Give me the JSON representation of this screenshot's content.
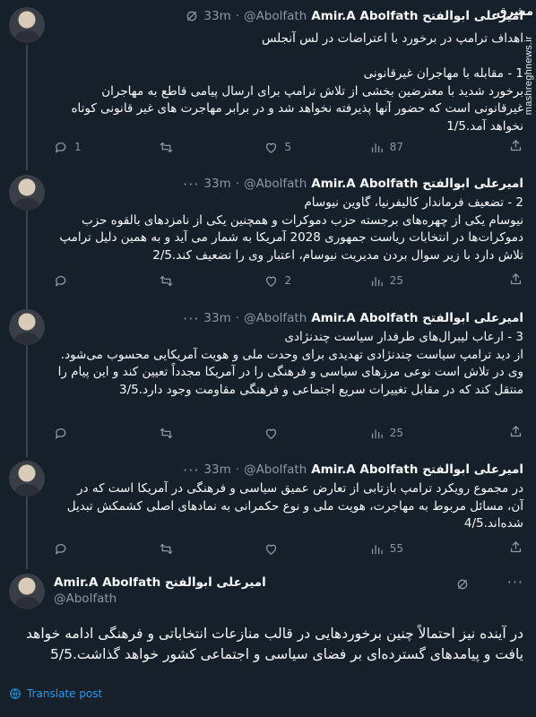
{
  "author": {
    "name": "Amir.A Abolfath امیرعلی ابوالفتح",
    "handle": "@Abolfath",
    "dot": "·",
    "time": "33m"
  },
  "tweets": [
    {
      "text": "اهداف ترامپ در برخورد با اعتراضات در لس آنجلس\n\n1 - مقابله با مهاجران غیرقانونی\nبرخورد شدید با معترضین بخشی از تلاش ترامپ برای ارسال پیامی قاطع به مهاجران غیرقانونی است که حضور آنها پذیرفته نخواهد شد و در برابر مهاجرت های غیر قانونی کوتاه نخواهد آمد.1/5",
      "replies": "1",
      "reposts": "",
      "likes": "5",
      "views": "87"
    },
    {
      "text": "2 - تضعیف فرماندار کالیفرنیا، گاوین نیوسام\nنیوسام یکی از چهره‌های برجسته حزب دموکرات و همچنین یکی از نامزدهای بالقوه حزب دموکرات‌ها در انتخابات ریاست جمهوری 2028 آمریکا به شمار می آید و به همین دلیل ترامپ تلاش دارد با زیر سوال بردن مدیریت نیوسام، اعتبار وی را تضعیف کند.2/5",
      "replies": "",
      "reposts": "",
      "likes": "2",
      "views": "25"
    },
    {
      "text": "3 - ارعاب لیبرال‌های طرفدار سیاست چندنژادی\nاز دید ترامپ سیاست چندنژادی تهدیدی برای وحدت ملی و هویت آمریکایی محسوب می‌شود. وی در تلاش است نوعی مرزهای سیاسی و فرهنگی را در آمریکا مجدداً تعیین کند و این پیام را منتقل کند که در مقابل تغییرات سریع اجتماعی و فرهنگی مقاومت وجود دارد.3/5",
      "replies": "",
      "reposts": "",
      "likes": "",
      "views": "25"
    },
    {
      "text": "در مجموع رویکرد ترامپ بازتابی از تعارض عمیق سیاسی و فرهنگی در آمریکا است که در آن، مسائل مربوط به مهاجرت، هویت ملی و نوع حکمرانی به نمادهای اصلی کشمکش تبدیل شده‌اند.4/5",
      "replies": "",
      "reposts": "",
      "likes": "",
      "views": "55"
    }
  ],
  "final_tweet": {
    "text": "در آینده نیز احتمالاً چنین برخوردهایی در قالب منازعات انتخاباتی و فرهنگی ادامه خواهد یافت و پیامدهای گسترده‌ای بر فضای سیاسی و اجتماعی کشور خواهد گذاشت.5/5",
    "translate_label": "Translate post"
  },
  "watermark": {
    "site": "mashreghnews.ir",
    "logo": "مشرق"
  },
  "colors": {
    "background": "#15202b",
    "text": "#f7f9f9",
    "muted": "#8b98a5",
    "link": "#1d9bf0",
    "line": "#38444d"
  },
  "icons": [
    "grok-icon",
    "more-icon",
    "reply-icon",
    "repost-icon",
    "like-icon",
    "views-icon",
    "share-icon",
    "globe-icon"
  ]
}
